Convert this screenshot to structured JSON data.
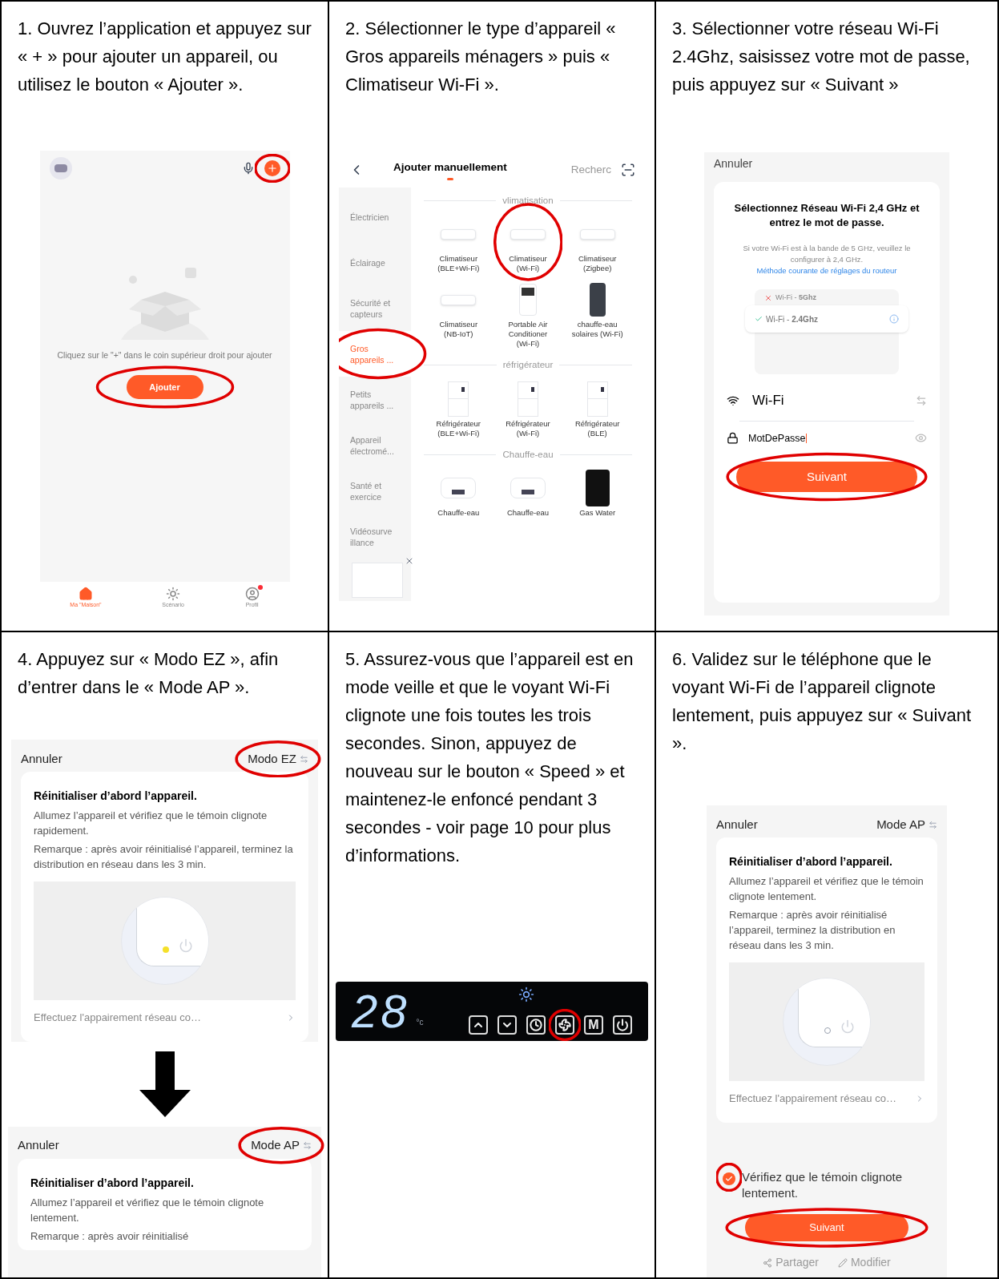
{
  "steps": [
    {
      "kind": "home",
      "instruction": "1. Ouvrez l’application et appuyez sur « + » pour ajouter un appareil, ou utilisez le bouton « Ajouter ».",
      "add_circled": true,
      "hint": "Cliquez sur le \"+\" dans le coin supérieur droit pour ajouter",
      "button": {
        "label": "Ajouter",
        "circled": true
      },
      "nav": [
        {
          "label": "Ma \"Maison\"",
          "kind": "home",
          "selected": true,
          "badge": false
        },
        {
          "label": "Scénario",
          "kind": "scene",
          "selected": false,
          "badge": false
        },
        {
          "label": "Profil",
          "kind": "profile",
          "selected": false,
          "badge": true
        }
      ]
    },
    {
      "kind": "catalog",
      "instruction": "2. Sélectionner le type d’appareil « Gros appareils ménagers » puis « Climatiseur Wi-Fi ».",
      "title": "Ajouter manuellement",
      "search": "Recherc",
      "categories": [
        {
          "label": "Électricien",
          "selected": false,
          "circled": false
        },
        {
          "label": "Éclairage",
          "selected": false,
          "circled": false
        },
        {
          "label": "Sécurité et capteurs",
          "selected": false,
          "circled": false
        },
        {
          "label": "Gros appareils ...",
          "selected": true,
          "circled": true
        },
        {
          "label": "Petits appareils ...",
          "selected": false,
          "circled": false
        },
        {
          "label": "Appareil électromé...",
          "selected": false,
          "circled": false
        },
        {
          "label": "Santé et exercice",
          "selected": false,
          "circled": false
        },
        {
          "label": "Vidéosurve illance",
          "selected": false,
          "circled": false
        }
      ],
      "sections": [
        {
          "title": "vlimatisation",
          "items": [
            {
              "label": "Climatiseur (BLE+Wi-Fi)",
              "kind": "ac",
              "circled": false
            },
            {
              "label": "Climatiseur (Wi-Fi)",
              "kind": "ac",
              "circled": true
            },
            {
              "label": "Climatiseur (Zigbee)",
              "kind": "ac",
              "circled": false
            },
            {
              "label": "Climatiseur (NB-IoT)",
              "kind": "ac",
              "circled": false
            },
            {
              "label": "Portable Air Conditioner (Wi-Fi)",
              "kind": "portable",
              "circled": false
            },
            {
              "label": "chauffe-eau solaires (Wi-Fi)",
              "kind": "solar",
              "circled": false
            }
          ]
        },
        {
          "title": "réfrigérateur",
          "items": [
            {
              "label": "Réfrigérateur (BLE+Wi-Fi)",
              "kind": "fridge",
              "circled": false
            },
            {
              "label": "Réfrigérateur (Wi-Fi)",
              "kind": "fridge",
              "circled": false
            },
            {
              "label": "Réfrigérateur (BLE)",
              "kind": "fridge",
              "circled": false
            }
          ]
        },
        {
          "title": "Chauffe-eau",
          "items": [
            {
              "label": "Chauffe-eau",
              "kind": "heater",
              "circled": false
            },
            {
              "label": "Chauffe-eau",
              "kind": "heater",
              "circled": false
            },
            {
              "label": "Gas Water",
              "kind": "gas",
              "circled": false
            }
          ]
        }
      ]
    },
    {
      "kind": "wifi",
      "instruction": "3. Sélectionner votre réseau Wi-Fi 2.4Ghz, saisissez votre mot de passe, puis appuyez sur « Suivant »",
      "cancel": "Annuler",
      "heading": "Sélectionnez Réseau Wi-Fi 2,4 GHz et entrez le mot de passe.",
      "note": "Si votre Wi-Fi est à  la bande de 5 GHz, veuillez le configurer à 2,4 GHz.",
      "link": "Méthode courante de réglages du routeur",
      "networks": [
        {
          "label": "Wi-Fi - **5Ghz**",
          "ok": false
        },
        {
          "label": "Wi-Fi - **2.4Ghz**",
          "ok": true
        }
      ],
      "network": "Wi-Fi",
      "password": "MotDePasse",
      "button": {
        "label": "Suivant",
        "circled": true
      }
    },
    {
      "kind": "modes",
      "instruction": "4. Appuyez sur « Modo EZ », afin d’entrer dans le « Mode AP ».",
      "screens": [
        {
          "cancel": "Annuler",
          "mode": "Modo EZ",
          "mode_circled": true,
          "title": "Réinitialiser d’abord l’appareil.",
          "body": [
            "Allumez l’appareil et vérifiez que le témoin clignote rapidement.",
            "Remarque : après avoir réinitialisé l’appareil, terminez la distribution en réseau dans les 3 min."
          ],
          "led_on": true,
          "link": "Effectuez l'appairement réseau co…"
        },
        {
          "cancel": "Annuler",
          "mode": "Mode AP",
          "mode_circled": true,
          "title": "Réinitialiser d’abord l’appareil.",
          "body": [
            "Allumez l’appareil et vérifiez que le témoin clignote lentement.",
            "Remarque : après avoir réinitialisé"
          ]
        }
      ]
    },
    {
      "kind": "panel",
      "instruction": "5. Assurez-vous que l’appareil est en mode veille et que le voyant Wi-Fi clignote une fois toutes les trois secondes. Sinon, appuyez de nouveau sur le bouton « Speed » et maintenez-le enfoncé pendant 3 secondes - voir page 10 pour plus d’informations.",
      "display": "28",
      "unit": "°c",
      "keys": [
        {
          "kind": "up"
        },
        {
          "kind": "down"
        },
        {
          "kind": "timer"
        },
        {
          "kind": "fan",
          "circled": true
        },
        {
          "kind": "mode",
          "label": "M"
        },
        {
          "kind": "power"
        }
      ]
    },
    {
      "kind": "confirm",
      "instruction": "6. Validez sur le téléphone que le voyant Wi-Fi de l’appareil clignote lentement, puis appuyez sur « Suivant ».",
      "cancel": "Annuler",
      "mode": "Mode AP",
      "title": "Réinitialiser d’abord l’appareil.",
      "body": [
        "Allumez l’appareil et vérifiez que le témoin clignote lentement.",
        "Remarque : après avoir réinitialisé l’appareil, terminez la distribution en réseau dans les 3 min."
      ],
      "led_on": false,
      "link": "Effectuez l'appairement réseau co…",
      "check": {
        "label": "Vérifiez que le témoin clignote lentement.",
        "checked": true,
        "circled": true
      },
      "button": {
        "label": "Suivant",
        "circled": true
      },
      "actions": [
        "Partager",
        "Modifier"
      ]
    }
  ]
}
